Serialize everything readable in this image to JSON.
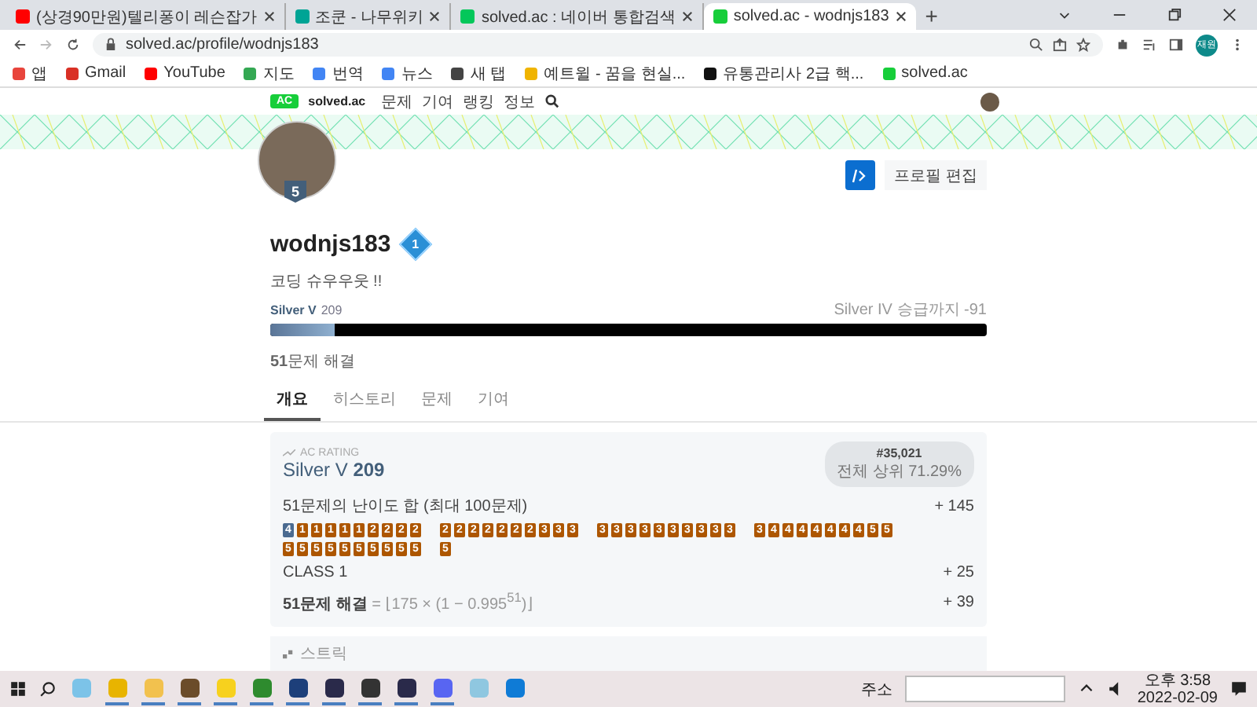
{
  "browser": {
    "tabs": [
      {
        "title": "(상경90만원)텔리퐁이 레슨잡가",
        "color": "#ff0000",
        "selected": false
      },
      {
        "title": "조쿤 - 나무위키",
        "color": "#00a495",
        "selected": false
      },
      {
        "title": "solved.ac : 네이버 통합검색",
        "color": "#03c75a",
        "selected": false
      },
      {
        "title": "solved.ac - wodnjs183",
        "color": "#17ce3a",
        "selected": true
      }
    ],
    "new_tab": "+",
    "url": "solved.ac/profile/wodnjs183",
    "profile_initials": "재원",
    "bookmarks": [
      {
        "label": "앱",
        "color": "#e8453c"
      },
      {
        "label": "Gmail",
        "color": "#d93025"
      },
      {
        "label": "YouTube",
        "color": "#ff0000"
      },
      {
        "label": "지도",
        "color": "#34a853"
      },
      {
        "label": "번역",
        "color": "#4285f4"
      },
      {
        "label": "뉴스",
        "color": "#4285f4"
      },
      {
        "label": "새 탭",
        "color": "#444444"
      },
      {
        "label": "예트윌 - 꿈을 현실...",
        "color": "#f0b400"
      },
      {
        "label": "유통관리사 2급 핵...",
        "color": "#111111"
      },
      {
        "label": "solved.ac",
        "color": "#17ce3a"
      }
    ]
  },
  "site": {
    "logo_mark": "AC",
    "logo_text": "solved.ac",
    "nav": [
      "문제",
      "기여",
      "랭킹",
      "정보"
    ]
  },
  "profile": {
    "tier_badge": "5",
    "edit_button": "프로필 편집",
    "username": "wodnjs183",
    "class_badge": "1",
    "bio": "코딩 슈우우웃 !!",
    "tier": "Silver V",
    "rating": "209",
    "next_tier": "Silver IV 승급까지 -91",
    "level": 0.09,
    "solved": "**51**문제 해결"
  },
  "tabs": [
    {
      "label": "개요",
      "selected": true
    },
    {
      "label": "히스토리",
      "selected": false
    },
    {
      "label": "문제",
      "selected": false
    },
    {
      "label": "기여",
      "selected": false
    }
  ],
  "rating_card": {
    "heading": "AC RATING",
    "tier": "Silver V",
    "rating": "209",
    "rank": "#35,021",
    "percentile": "전체 상위 71.29%",
    "difficulty_label": "51문제의 난이도 합 (최대 100문제)",
    "difficulty_score": "+ 145",
    "problem_groups": [
      [
        {
          "label": "4",
          "color": "#4a6a90"
        },
        {
          "label": "1",
          "color": "#ad5600"
        },
        {
          "label": "1",
          "color": "#ad5600"
        },
        {
          "label": "1",
          "color": "#ad5600"
        },
        {
          "label": "1",
          "color": "#ad5600"
        },
        {
          "label": "1",
          "color": "#ad5600"
        },
        {
          "label": "2",
          "color": "#ad5600"
        },
        {
          "label": "2",
          "color": "#ad5600"
        },
        {
          "label": "2",
          "color": "#ad5600"
        },
        {
          "label": "2",
          "color": "#ad5600"
        }
      ],
      [
        {
          "label": "2",
          "color": "#ad5600"
        },
        {
          "label": "2",
          "color": "#ad5600"
        },
        {
          "label": "2",
          "color": "#ad5600"
        },
        {
          "label": "2",
          "color": "#ad5600"
        },
        {
          "label": "2",
          "color": "#ad5600"
        },
        {
          "label": "2",
          "color": "#ad5600"
        },
        {
          "label": "2",
          "color": "#ad5600"
        },
        {
          "label": "3",
          "color": "#ad5600"
        },
        {
          "label": "3",
          "color": "#ad5600"
        },
        {
          "label": "3",
          "color": "#ad5600"
        }
      ],
      [
        {
          "label": "3",
          "color": "#ad5600"
        },
        {
          "label": "3",
          "color": "#ad5600"
        },
        {
          "label": "3",
          "color": "#ad5600"
        },
        {
          "label": "3",
          "color": "#ad5600"
        },
        {
          "label": "3",
          "color": "#ad5600"
        },
        {
          "label": "3",
          "color": "#ad5600"
        },
        {
          "label": "3",
          "color": "#ad5600"
        },
        {
          "label": "3",
          "color": "#ad5600"
        },
        {
          "label": "3",
          "color": "#ad5600"
        },
        {
          "label": "3",
          "color": "#ad5600"
        }
      ],
      [
        {
          "label": "3",
          "color": "#ad5600"
        },
        {
          "label": "4",
          "color": "#ad5600"
        },
        {
          "label": "4",
          "color": "#ad5600"
        },
        {
          "label": "4",
          "color": "#ad5600"
        },
        {
          "label": "4",
          "color": "#ad5600"
        },
        {
          "label": "4",
          "color": "#ad5600"
        },
        {
          "label": "4",
          "color": "#ad5600"
        },
        {
          "label": "4",
          "color": "#ad5600"
        },
        {
          "label": "5",
          "color": "#ad5600"
        },
        {
          "label": "5",
          "color": "#ad5600"
        }
      ],
      [
        {
          "label": "5",
          "color": "#ad5600"
        },
        {
          "label": "5",
          "color": "#ad5600"
        },
        {
          "label": "5",
          "color": "#ad5600"
        },
        {
          "label": "5",
          "color": "#ad5600"
        },
        {
          "label": "5",
          "color": "#ad5600"
        },
        {
          "label": "5",
          "color": "#ad5600"
        },
        {
          "label": "5",
          "color": "#ad5600"
        },
        {
          "label": "5",
          "color": "#ad5600"
        },
        {
          "label": "5",
          "color": "#ad5600"
        },
        {
          "label": "5",
          "color": "#ad5600"
        }
      ],
      [
        {
          "label": "5",
          "color": "#ad5600"
        }
      ]
    ],
    "class_label": "CLASS 1",
    "class_score": "+ 25",
    "solved_formula": "**51문제 해결** = ⌊175 × (1 − 0.995$^{51}$)⌋",
    "solved_score": "+ 39"
  },
  "streak_card": {
    "heading": "스트릭"
  },
  "taskbar": {
    "apps": [
      {
        "color": "#7cc3e8",
        "running": false
      },
      {
        "color": "#e8b400",
        "running": true
      },
      {
        "color": "#f2c14e",
        "running": true
      },
      {
        "color": "#6b4c2a",
        "running": true
      },
      {
        "color": "#f7d11e",
        "running": true
      },
      {
        "color": "#2e8b2e",
        "running": true
      },
      {
        "color": "#1d3f7a",
        "running": true
      },
      {
        "color": "#2a2a4a",
        "running": true
      },
      {
        "color": "#333333",
        "running": true
      },
      {
        "color": "#2a2a4a",
        "running": true
      },
      {
        "color": "#5865f2",
        "running": true
      },
      {
        "color": "#8fc7e0",
        "running": false
      },
      {
        "color": "#0f7bd6",
        "running": false
      }
    ],
    "address_label": "주소",
    "time": "오후 3:58",
    "date": "2022-02-09"
  }
}
